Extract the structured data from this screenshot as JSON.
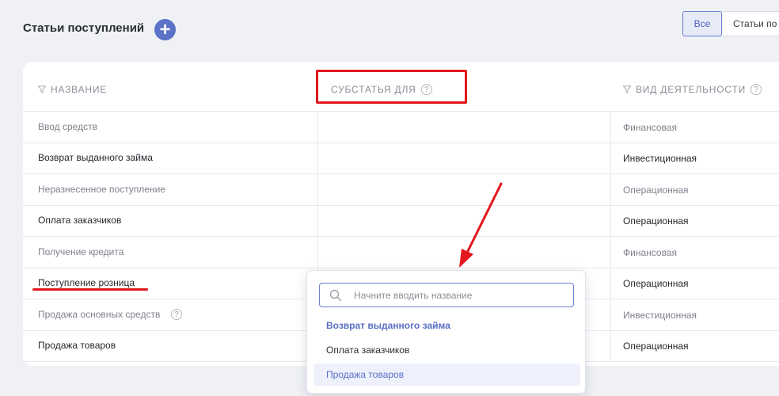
{
  "header": {
    "title": "Статьи поступлений",
    "add_symbol": "+",
    "filters": [
      {
        "label": "Все",
        "active": true
      },
      {
        "label": "Статьи по",
        "active": false
      }
    ]
  },
  "table": {
    "columns": [
      {
        "label": "Название",
        "has_filter_icon": true,
        "has_help_icon": false
      },
      {
        "label": "Субстатья для",
        "has_filter_icon": false,
        "has_help_icon": true
      },
      {
        "label": "Вид деятельности",
        "has_filter_icon": true,
        "has_help_icon": true
      }
    ],
    "help_symbol": "?",
    "rows": [
      {
        "name": "Ввод средств",
        "parent": "",
        "activity": "Финансовая",
        "muted": true
      },
      {
        "name": "Возврат выданного займа",
        "parent": "",
        "activity": "Инвестиционная",
        "muted": false
      },
      {
        "name": "Неразнесенное поступление",
        "parent": "",
        "activity": "Операционная",
        "muted": true
      },
      {
        "name": "Оплата заказчиков",
        "parent": "",
        "activity": "Операционная",
        "muted": false
      },
      {
        "name": "Получение кредита",
        "parent": "",
        "activity": "Финансовая",
        "muted": true
      },
      {
        "name": "Поступление розница",
        "parent": "",
        "activity": "Операционная",
        "muted": false
      },
      {
        "name": "Продажа основных средств",
        "parent": "",
        "activity": "Инвестиционная",
        "muted": true,
        "has_help_icon": true
      },
      {
        "name": "Продажа товаров",
        "parent": "",
        "activity": "Операционная",
        "muted": false
      }
    ]
  },
  "dropdown": {
    "search_placeholder": "Начните вводить название",
    "options": [
      {
        "label": "Возврат выданного займа",
        "state": "selected"
      },
      {
        "label": "Оплата заказчиков",
        "state": "normal"
      },
      {
        "label": "Продажа товаров",
        "state": "hover"
      }
    ]
  },
  "annotations": {
    "color": "#e3171d"
  },
  "colors": {
    "accent": "#5c72c9",
    "background": "#eff1f5"
  }
}
